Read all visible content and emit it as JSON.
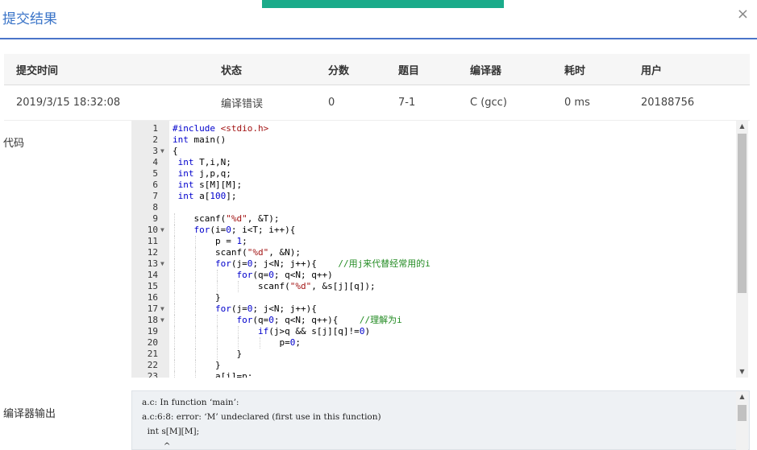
{
  "dialog": {
    "title": "提交结果",
    "close": "×"
  },
  "table": {
    "headers": [
      "提交时间",
      "状态",
      "分数",
      "题目",
      "编译器",
      "耗时",
      "用户"
    ],
    "row": {
      "time": "2019/3/15 18:32:08",
      "status": "编译错误",
      "score": "0",
      "problem": "7-1",
      "compiler": "C (gcc)",
      "elapsed": "0 ms",
      "user": "20188756"
    }
  },
  "code_section": {
    "label": "代码",
    "lines": [
      {
        "n": "1",
        "fold": "",
        "code": "#include <stdio.h>"
      },
      {
        "n": "2",
        "fold": "",
        "code": "int main()"
      },
      {
        "n": "3",
        "fold": "▼",
        "code": "{"
      },
      {
        "n": "4",
        "fold": "",
        "code": " int T,i,N;"
      },
      {
        "n": "5",
        "fold": "",
        "code": " int j,p,q;"
      },
      {
        "n": "6",
        "fold": "",
        "code": " int s[M][M];"
      },
      {
        "n": "7",
        "fold": "",
        "code": " int a[100];"
      },
      {
        "n": "8",
        "fold": "",
        "code": ""
      },
      {
        "n": "9",
        "fold": "",
        "code": "    scanf(\"%d\", &T);"
      },
      {
        "n": "10",
        "fold": "▼",
        "code": "    for(i=0; i<T; i++){"
      },
      {
        "n": "11",
        "fold": "",
        "code": "        p = 1;"
      },
      {
        "n": "12",
        "fold": "",
        "code": "        scanf(\"%d\", &N);"
      },
      {
        "n": "13",
        "fold": "▼",
        "code": "        for(j=0; j<N; j++){    //用j来代替经常用的i"
      },
      {
        "n": "14",
        "fold": "",
        "code": "            for(q=0; q<N; q++)"
      },
      {
        "n": "15",
        "fold": "",
        "code": "                scanf(\"%d\", &s[j][q]);"
      },
      {
        "n": "16",
        "fold": "",
        "code": "        }"
      },
      {
        "n": "17",
        "fold": "▼",
        "code": "        for(j=0; j<N; j++){"
      },
      {
        "n": "18",
        "fold": "▼",
        "code": "            for(q=0; q<N; q++){    //理解为i"
      },
      {
        "n": "19",
        "fold": "",
        "code": "                if(j>q && s[j][q]!=0)"
      },
      {
        "n": "20",
        "fold": "",
        "code": "                    p=0;"
      },
      {
        "n": "21",
        "fold": "",
        "code": "            }"
      },
      {
        "n": "22",
        "fold": "",
        "code": "        }"
      },
      {
        "n": "23",
        "fold": "",
        "code": "        a[i]=p;"
      }
    ]
  },
  "output_section": {
    "label": "编译器输出",
    "lines": [
      "a.c: In function ‘main’:",
      "a.c:6:8: error: ‘M’ undeclared (first use in this function)",
      "  int s[M][M];",
      "        ^"
    ]
  },
  "icons": {
    "fold": "chevron-down-icon",
    "scroll_up": "caret-up-icon",
    "scroll_down": "caret-down-icon"
  },
  "colors": {
    "accent": "#1aab8a",
    "title": "#3a74c8",
    "link": "#2a7ac7",
    "header_rule": "#4a74c9"
  }
}
